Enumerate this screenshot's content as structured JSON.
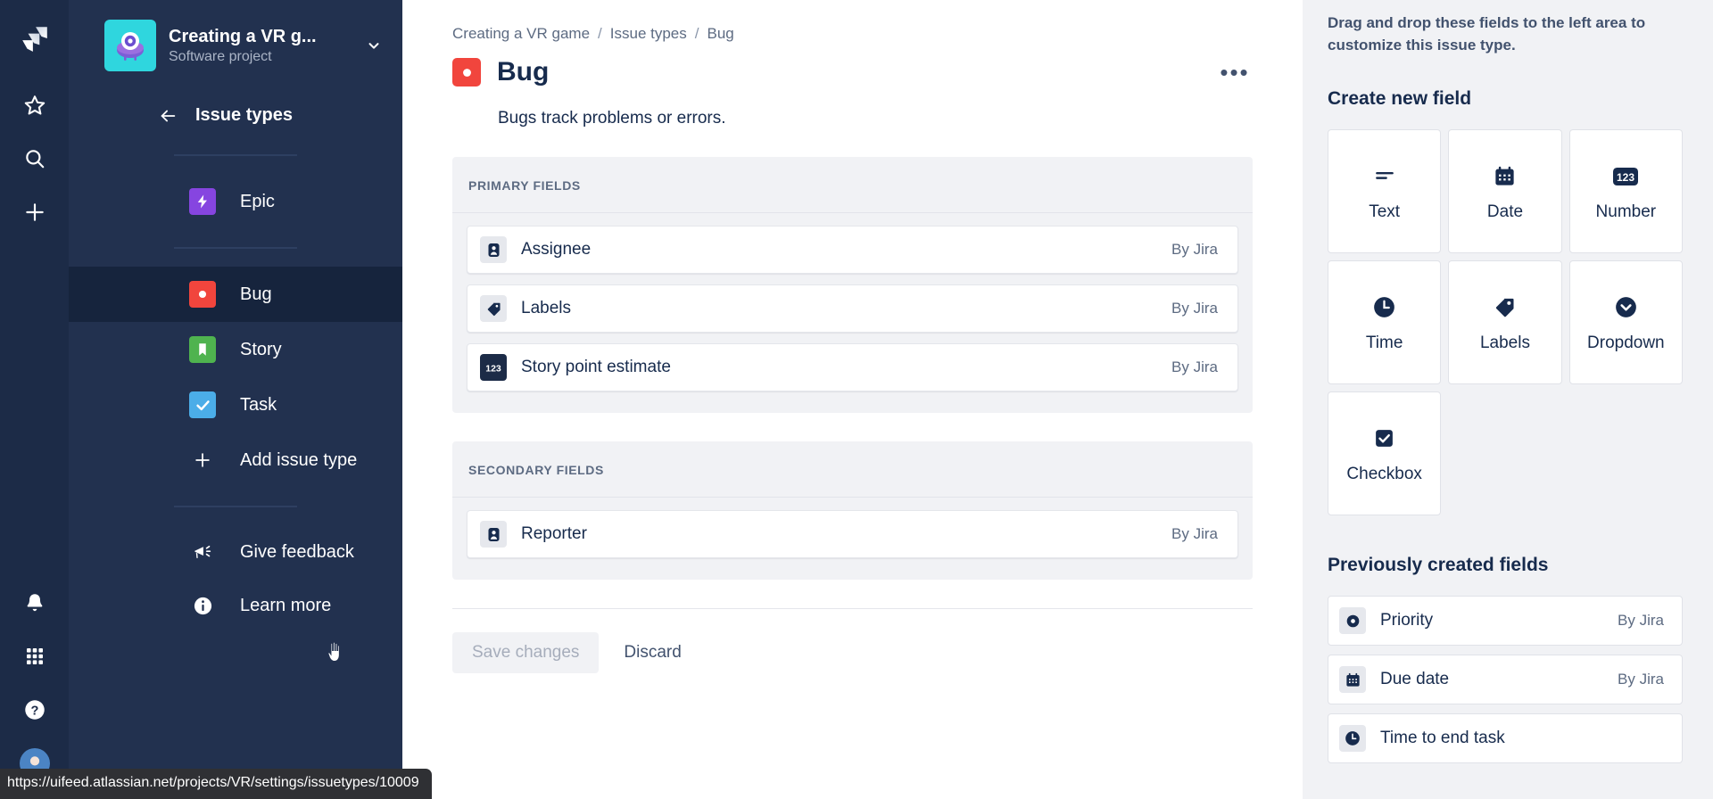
{
  "rail": {
    "items": [
      {
        "name": "jira-logo",
        "label": "Jira"
      },
      {
        "name": "starred-icon",
        "label": "Starred"
      },
      {
        "name": "search-icon",
        "label": "Search"
      },
      {
        "name": "create-icon",
        "label": "Create"
      },
      {
        "name": "notifications-icon",
        "label": "Notifications"
      },
      {
        "name": "app-switcher-icon",
        "label": "App switcher"
      },
      {
        "name": "help-icon",
        "label": "Help"
      },
      {
        "name": "profile-avatar",
        "label": "Your profile"
      }
    ]
  },
  "sidebar": {
    "project": {
      "title": "Creating a VR g...",
      "subtitle": "Software project",
      "chevron": "chevron-down-icon"
    },
    "back": {
      "label": "Issue types",
      "icon": "arrow-left-icon"
    },
    "groups": [
      {
        "items": [
          {
            "label": "Epic",
            "icon": "epic-icon",
            "active": false
          }
        ]
      },
      {
        "items": [
          {
            "label": "Bug",
            "icon": "bug-icon",
            "active": true
          },
          {
            "label": "Story",
            "icon": "story-icon",
            "active": false
          },
          {
            "label": "Task",
            "icon": "task-icon",
            "active": false
          },
          {
            "label": "Add issue type",
            "icon": "plus-icon",
            "active": false
          }
        ]
      }
    ],
    "footer": [
      {
        "label": "Give feedback",
        "icon": "megaphone-icon"
      },
      {
        "label": "Learn more",
        "icon": "info-icon"
      }
    ]
  },
  "main": {
    "breadcrumb": [
      "Creating a VR game",
      "Issue types",
      "Bug"
    ],
    "breadcrumb_separator": "/",
    "title": "Bug",
    "title_icon": "bug-icon",
    "more_actions_label": "•••",
    "description": "Bugs track problems or errors.",
    "sections": [
      {
        "heading": "PRIMARY FIELDS",
        "fields": [
          {
            "name": "Assignee",
            "by": "By Jira",
            "icon": "user-icon"
          },
          {
            "name": "Labels",
            "by": "By Jira",
            "icon": "label-icon"
          },
          {
            "name": "Story point estimate",
            "by": "By Jira",
            "icon": "number-icon"
          }
        ]
      },
      {
        "heading": "SECONDARY FIELDS",
        "fields": [
          {
            "name": "Reporter",
            "by": "By Jira",
            "icon": "user-icon"
          }
        ]
      }
    ],
    "actions": {
      "save_label": "Save changes",
      "discard_label": "Discard"
    }
  },
  "rightpanel": {
    "intro": "Drag and drop these fields to the left area to customize this issue type.",
    "create_heading": "Create new field",
    "tiles": [
      {
        "label": "Text",
        "icon": "text-icon"
      },
      {
        "label": "Date",
        "icon": "calendar-icon"
      },
      {
        "label": "Number",
        "icon": "number-icon"
      },
      {
        "label": "Time",
        "icon": "clock-icon"
      },
      {
        "label": "Labels",
        "icon": "label-icon"
      },
      {
        "label": "Dropdown",
        "icon": "chevron-down-circle-icon"
      },
      {
        "label": "Checkbox",
        "icon": "checkbox-icon"
      }
    ],
    "previous_heading": "Previously created fields",
    "previous_fields": [
      {
        "label": "Priority",
        "by": "By Jira",
        "icon": "priority-icon"
      },
      {
        "label": "Due date",
        "by": "By Jira",
        "icon": "calendar-icon"
      },
      {
        "label": "Time to end task",
        "by": "",
        "icon": "clock-icon"
      }
    ]
  },
  "statusbar": {
    "url": "https://uifeed.atlassian.net/projects/VR/settings/issuetypes/10009"
  },
  "colors": {
    "rail_bg": "#1c2b47",
    "sidebar_bg": "#22314f",
    "sidebar_active": "#16243d",
    "bug_red": "#f1453d",
    "epic_purple": "#8645e0",
    "story_green": "#4fb34f",
    "task_blue": "#4bade8",
    "panel_bg": "#f1f2f5",
    "text_primary": "#172b4d",
    "text_muted": "#5d6b82"
  }
}
